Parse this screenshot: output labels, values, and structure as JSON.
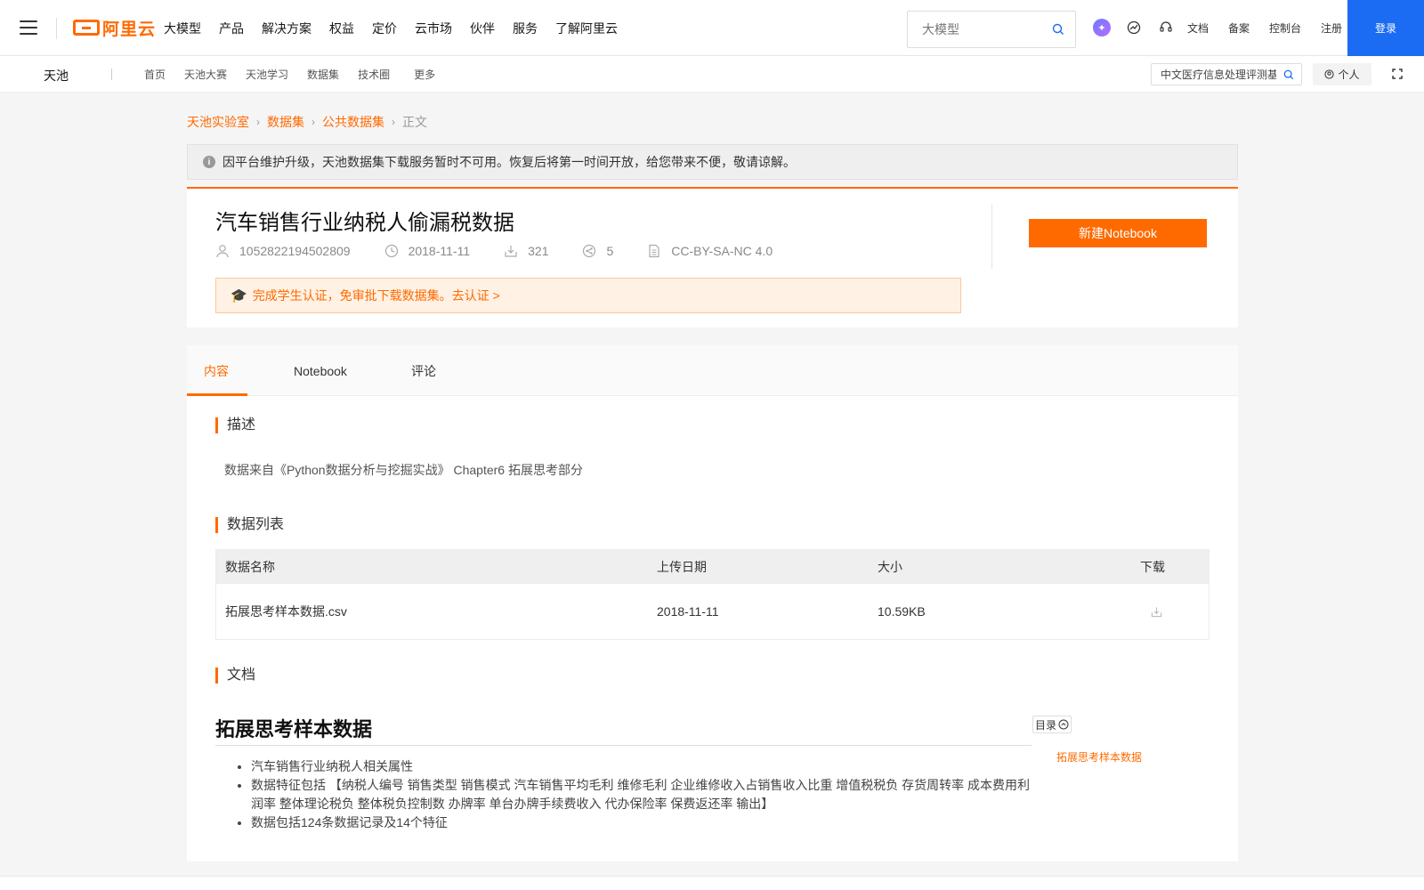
{
  "topnav": {
    "logo_text": "阿里云",
    "items": [
      "大模型",
      "产品",
      "解决方案",
      "权益",
      "定价",
      "云市场",
      "伙伴",
      "服务",
      "了解阿里云"
    ],
    "search_placeholder": "大模型",
    "links": [
      "文档",
      "备案",
      "控制台",
      "注册"
    ],
    "login": "登录"
  },
  "subnav": {
    "brand": "天池",
    "items": [
      "首页",
      "天池大赛",
      "天池学习",
      "数据集",
      "技术圈"
    ],
    "more": "更多",
    "search_value": "中文医疗信息处理评测基",
    "personal": "个人"
  },
  "breadcrumb": [
    "天池实验室",
    "数据集",
    "公共数据集",
    "正文"
  ],
  "notice": "因平台维护升级，天池数据集下载服务暂时不可用。恢复后将第一时间开放，给您带来不便，敬请谅解。",
  "dataset": {
    "title": "汽车销售行业纳税人偷漏税数据",
    "author": "1052822194502809",
    "date": "2018-11-11",
    "downloads": "321",
    "shares": "5",
    "license": "CC-BY-SA-NC 4.0",
    "cert_text": "完成学生认证，免审批下载数据集。去认证 >",
    "notebook_button": "新建Notebook"
  },
  "tabs": [
    "内容",
    "Notebook",
    "评论"
  ],
  "sections": {
    "desc_title": "描述",
    "desc_text": "数据来自《Python数据分析与挖掘实战》 Chapter6 拓展思考部分",
    "list_title": "数据列表",
    "doc_title": "文档"
  },
  "table": {
    "headers": [
      "数据名称",
      "上传日期",
      "大小",
      "下载"
    ],
    "rows": [
      {
        "name": "拓展思考样本数据.csv",
        "date": "2018-11-11",
        "size": "10.59KB"
      }
    ]
  },
  "document": {
    "heading": "拓展思考样本数据",
    "toc_label": "目录",
    "toc_items": [
      "拓展思考样本数据"
    ],
    "bullets": [
      "汽车销售行业纳税人相关属性",
      "数据特征包括 【纳税人编号 销售类型 销售模式 汽车销售平均毛利 维修毛利 企业维修收入占销售收入比重 增值税税负 存货周转率 成本费用利润率 整体理论税负 整体税负控制数 办牌率 单台办牌手续费收入 代办保险率 保费返还率 输出】",
      "数据包括124条数据记录及14个特征"
    ]
  },
  "colors": {
    "accent": "#ff6a00",
    "login_blue": "#1b6cf2"
  }
}
